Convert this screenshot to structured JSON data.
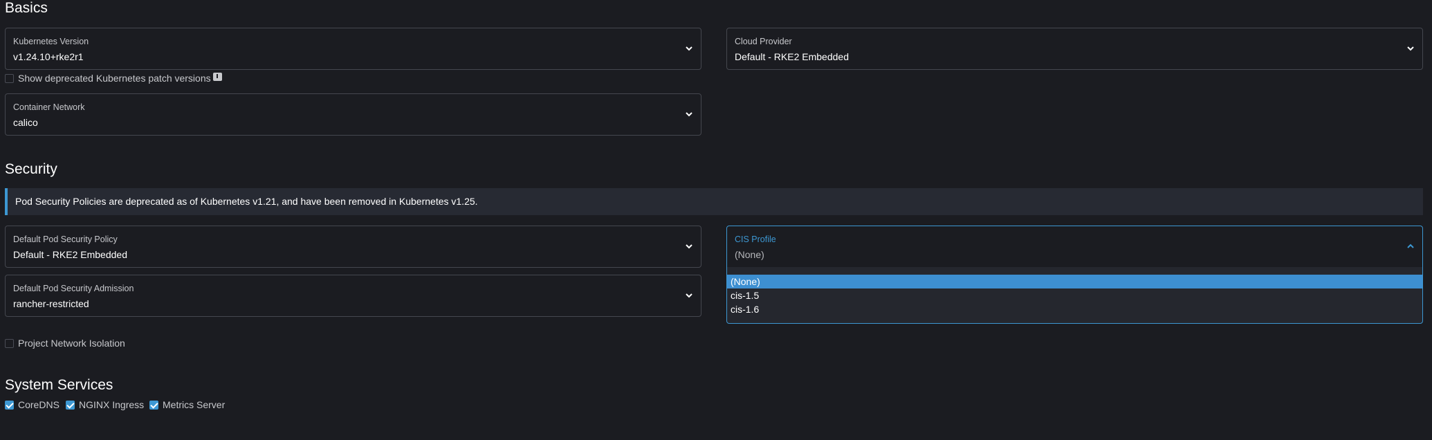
{
  "basics": {
    "title": "Basics",
    "kubernetes_version": {
      "label": "Kubernetes Version",
      "value": "v1.24.10+rke2r1"
    },
    "cloud_provider": {
      "label": "Cloud Provider",
      "value": "Default - RKE2 Embedded"
    },
    "show_deprecated": {
      "label": "Show deprecated Kubernetes patch versions",
      "checked": false
    },
    "container_network": {
      "label": "Container Network",
      "value": "calico"
    }
  },
  "security": {
    "title": "Security",
    "banner_text": "Pod Security Policies are deprecated as of Kubernetes v1.21, and have been removed in Kubernetes v1.25.",
    "default_psp": {
      "label": "Default Pod Security Policy",
      "value": "Default - RKE2 Embedded"
    },
    "cis_profile": {
      "label": "CIS Profile",
      "value": "(None)",
      "options": [
        "(None)",
        "cis-1.5",
        "cis-1.6"
      ],
      "selected_index": 0
    },
    "default_psa": {
      "label": "Default Pod Security Admission",
      "value": "rancher-restricted"
    },
    "project_network_isolation": {
      "label": "Project Network Isolation",
      "checked": false
    }
  },
  "system_services": {
    "title": "System Services",
    "items": [
      {
        "label": "CoreDNS",
        "checked": true
      },
      {
        "label": "NGINX Ingress",
        "checked": true
      },
      {
        "label": "Metrics Server",
        "checked": true
      }
    ]
  },
  "colors": {
    "accent": "#3d98d3",
    "background": "#1b1c21",
    "banner_bg": "#272a33"
  }
}
